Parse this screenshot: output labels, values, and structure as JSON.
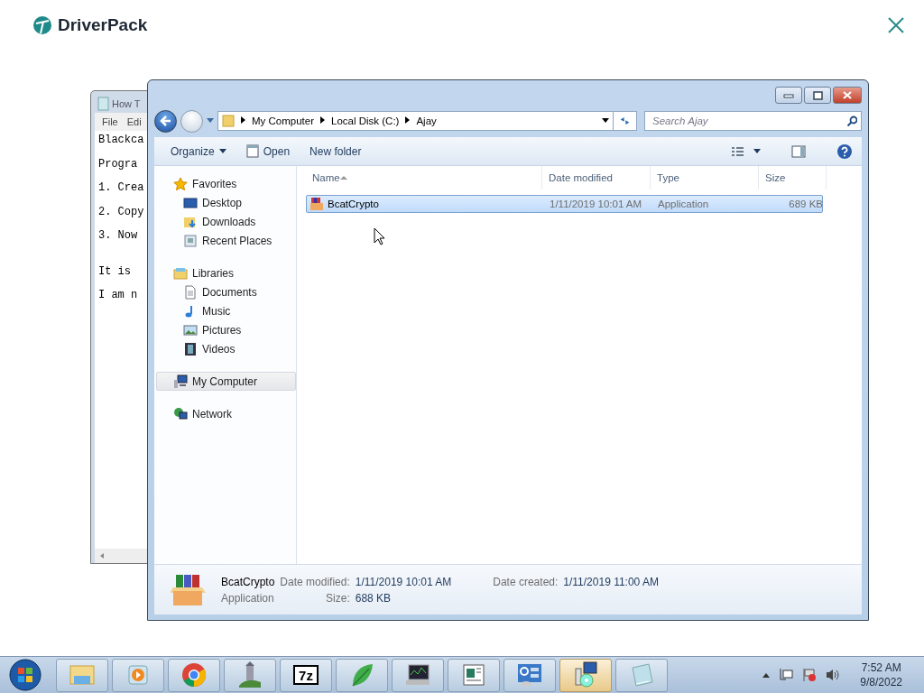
{
  "header": {
    "logo": "DriverPack"
  },
  "notepad": {
    "title": "How T",
    "menu": [
      "File",
      "Edi"
    ],
    "paragraphs": [
      [
        "Blackca",
        "Progra",
        "1. Crea",
        "2. Copy",
        "3. Now"
      ],
      [
        "It is",
        "I am n"
      ]
    ]
  },
  "explorer": {
    "breadcrumb": [
      "My Computer",
      "Local Disk (C:)",
      "Ajay"
    ],
    "search": {
      "placeholder": "Search Ajay"
    },
    "toolbar": [
      {
        "label": "Organize",
        "kind": "menu"
      },
      {
        "label": "Open",
        "kind": "open"
      },
      {
        "label": "New folder",
        "kind": "plain"
      }
    ],
    "nav": [
      {
        "label": "Favorites",
        "kind": "star",
        "selected": false,
        "children": [
          {
            "label": "Desktop",
            "kind": "desktop",
            "selected": false
          },
          {
            "label": "Downloads",
            "kind": "downloads",
            "selected": false
          },
          {
            "label": "Recent Places",
            "kind": "recent",
            "selected": false
          }
        ]
      },
      {
        "label": "Libraries",
        "kind": "library",
        "selected": false,
        "children": [
          {
            "label": "Documents",
            "kind": "document",
            "selected": false
          },
          {
            "label": "Music",
            "kind": "music",
            "selected": false
          },
          {
            "label": "Pictures",
            "kind": "pictures",
            "selected": false
          },
          {
            "label": "Videos",
            "kind": "videos",
            "selected": false
          }
        ]
      },
      {
        "label": "My Computer",
        "kind": "computer",
        "selected": true
      },
      {
        "label": "Network",
        "kind": "network",
        "selected": false
      }
    ],
    "columns": [
      "Name",
      "Date modified",
      "Type",
      "Size"
    ],
    "rows": [
      {
        "name": "BcatCrypto",
        "date": "1/11/2019 10:01 AM",
        "type": "Application",
        "size": "689 KB",
        "selected": true
      }
    ],
    "details": {
      "name": "BcatCrypto",
      "type": "Application",
      "modified_label": "Date modified:",
      "modified": "1/11/2019 10:01 AM",
      "size_label": "Size:",
      "size": "688 KB",
      "created_label": "Date created:",
      "created": "1/11/2019 11:00 AM"
    }
  },
  "taskbar": {
    "apps": [
      {
        "kind": "folder",
        "active": false
      },
      {
        "kind": "media",
        "active": false
      },
      {
        "kind": "chrome",
        "active": false
      },
      {
        "kind": "castle",
        "active": false
      },
      {
        "kind": "archive",
        "label": "7z",
        "active": false
      },
      {
        "kind": "leaf",
        "active": false
      },
      {
        "kind": "monitor",
        "active": false
      },
      {
        "kind": "document",
        "active": false
      },
      {
        "kind": "panel",
        "active": false
      },
      {
        "kind": "setup",
        "active": true
      },
      {
        "kind": "notepad",
        "active": false
      }
    ],
    "time": "7:52 AM",
    "date": "9/8/2022"
  }
}
